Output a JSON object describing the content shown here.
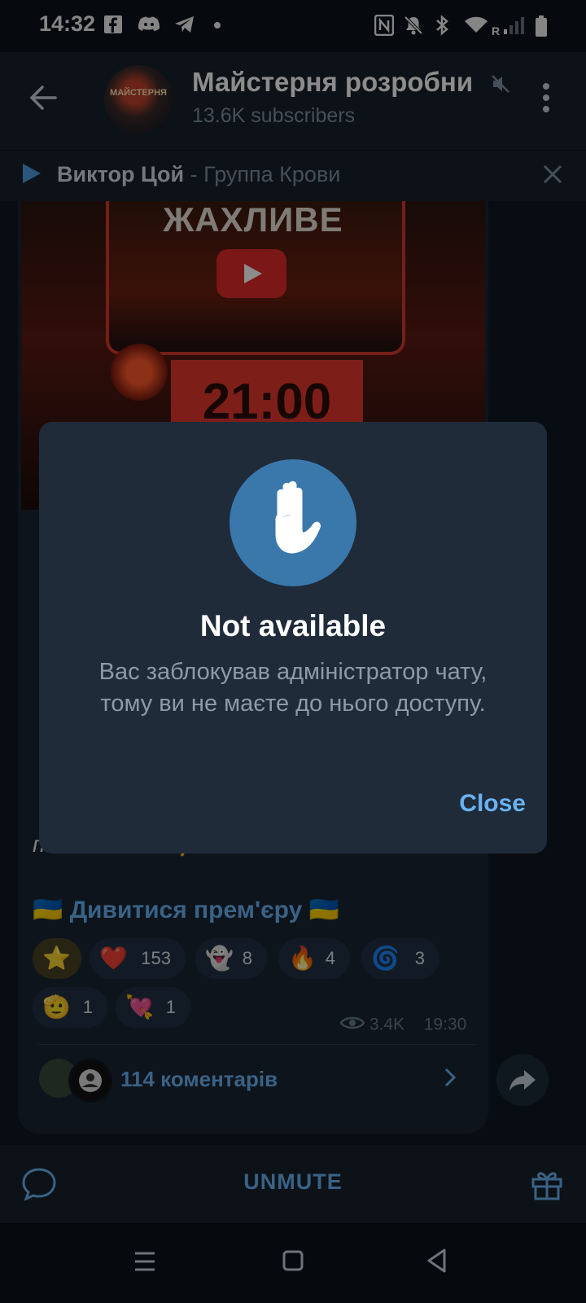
{
  "status_bar": {
    "time": "14:32",
    "left_icons": [
      "facebook-icon",
      "discord-icon",
      "telegram-icon",
      "dot-icon"
    ],
    "right_icons": [
      "nfc-icon",
      "bell-off-icon",
      "bluetooth-icon",
      "wifi-icon",
      "signal-icon",
      "battery-icon"
    ],
    "roaming": "R"
  },
  "header": {
    "channel_title": "Майстерня розробни",
    "subscribers": "13.6K subscribers",
    "avatar_text": "МАЙСТЕРНЯ"
  },
  "music_bar": {
    "artist": "Виктор Цой",
    "separator": " - ",
    "track": "Группа Крови"
  },
  "post": {
    "thumbnail_title": "ЖАХЛИВЕ",
    "thumbnail_time": "21:00",
    "text_line": "посиланням 👇",
    "link_text": "🇺🇦 Дивитися прем'єру 🇺🇦",
    "reactions": [
      {
        "emoji": "⭐",
        "count": ""
      },
      {
        "emoji": "❤️",
        "count": "153"
      },
      {
        "emoji": "👻",
        "count": "8"
      },
      {
        "emoji": "🔥",
        "count": "4"
      },
      {
        "emoji": "🌀",
        "count": "3"
      },
      {
        "emoji": "🫡",
        "count": "1"
      },
      {
        "emoji": "💘",
        "count": "1"
      }
    ],
    "views": "3.4K",
    "time": "19:30",
    "comments": "114 коментарів"
  },
  "bottom_bar": {
    "unmute_label": "UNMUTE"
  },
  "dialog": {
    "title": "Not available",
    "message": "Вас заблокував адміністратор чату, тому ви не маєте до нього доступу.",
    "close_label": "Close"
  },
  "colors": {
    "accent": "#6ab2f2",
    "background": "#0e1621",
    "header": "#17212b",
    "dialog": "#1f2b39",
    "hand_circle": "#3a78ac"
  }
}
